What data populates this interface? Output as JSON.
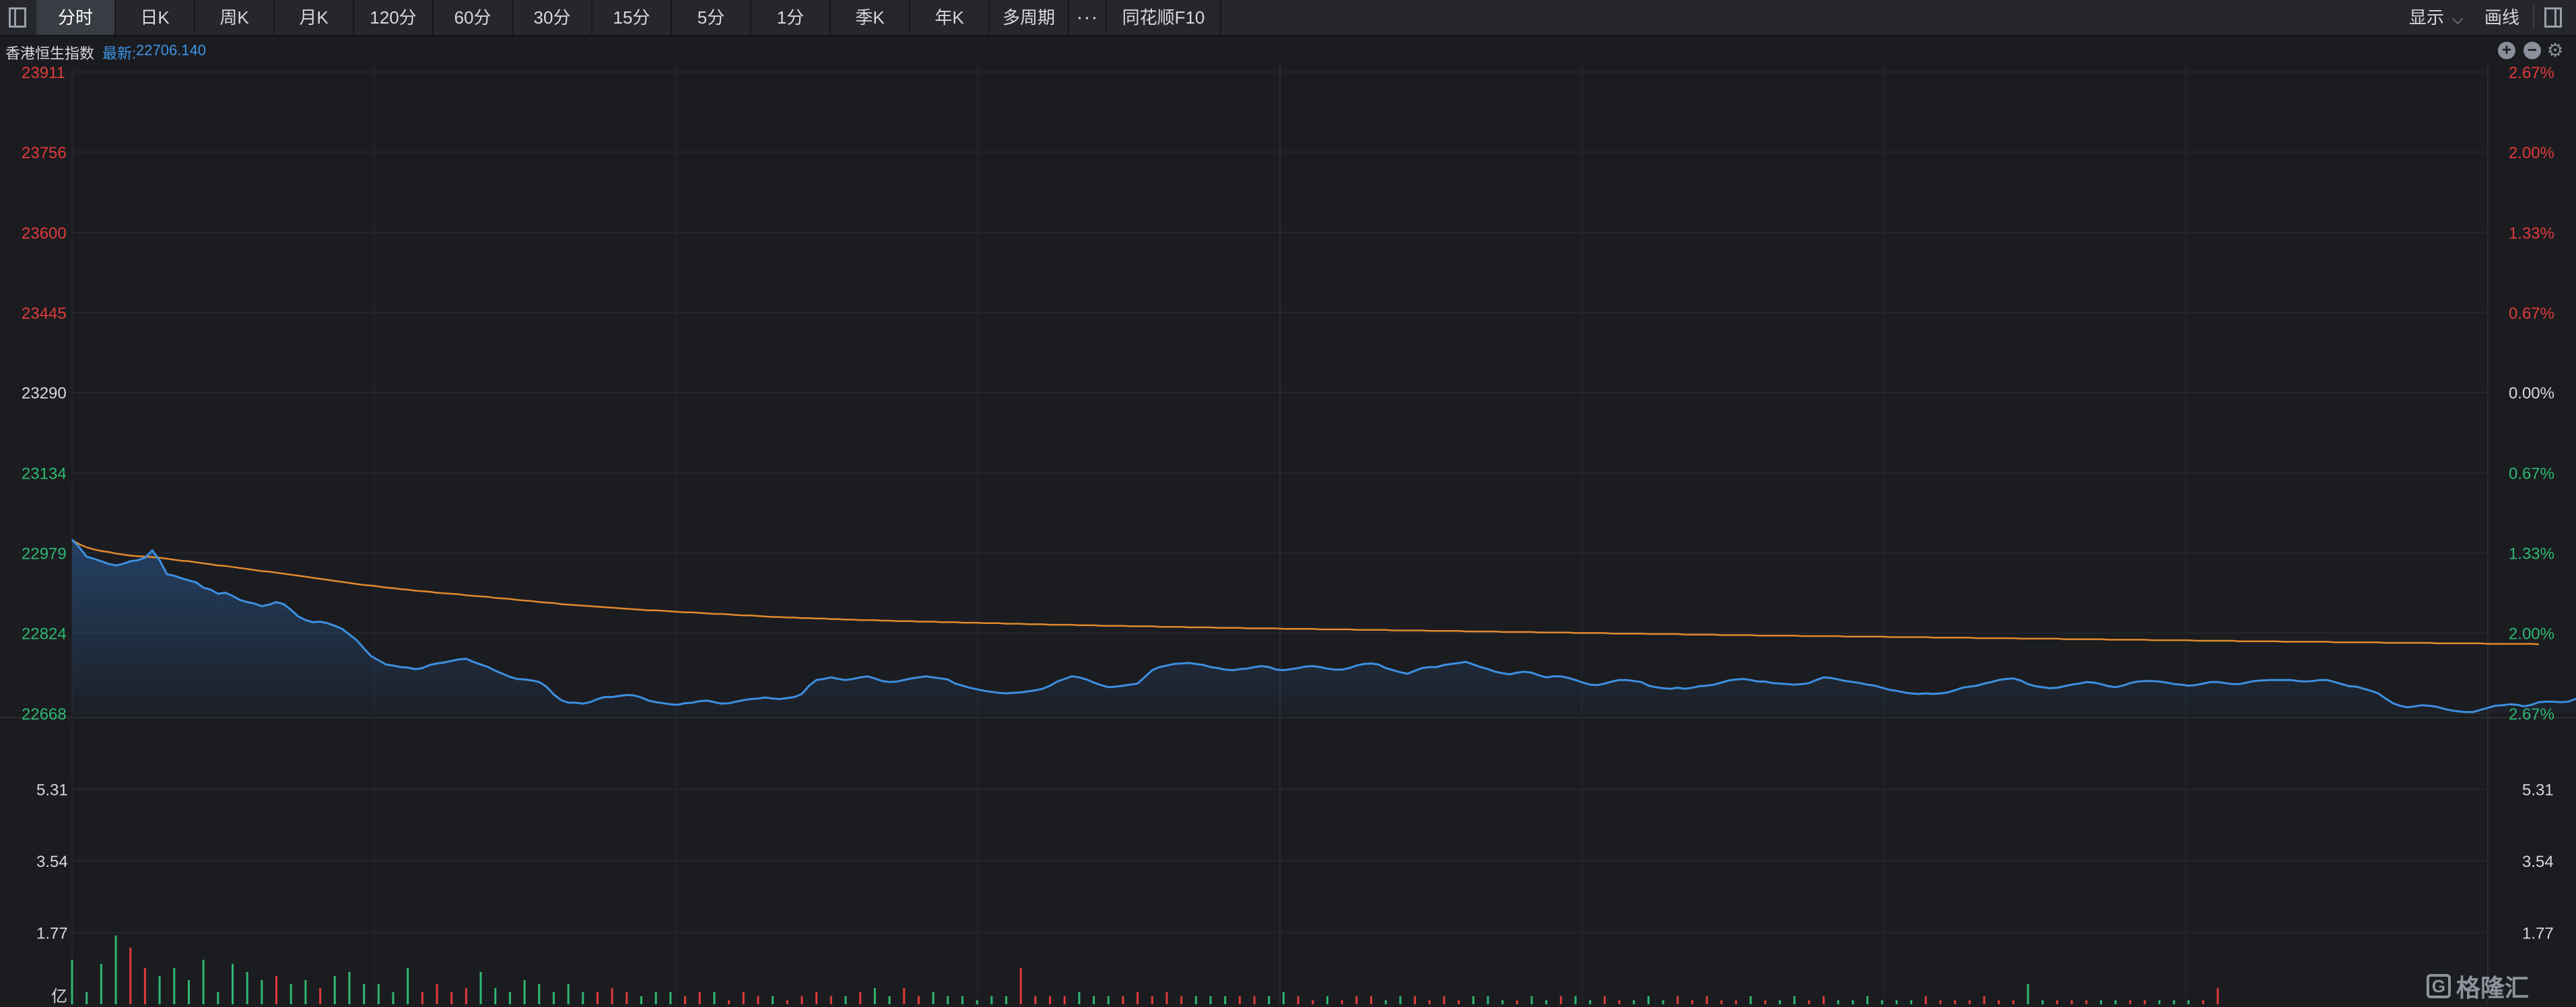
{
  "toolbar": {
    "tabs": [
      "分时",
      "日K",
      "周K",
      "月K",
      "120分",
      "60分",
      "30分",
      "15分",
      "5分",
      "1分",
      "季K",
      "年K",
      "多周期"
    ],
    "active_tab": "分时",
    "more": "···",
    "f10": "同花顺F10",
    "show_label": "显示",
    "draw_label": "画线"
  },
  "info": {
    "name": "香港恒生指数",
    "latest_label": "最新:",
    "latest_value": "22706.140"
  },
  "colors": {
    "up": "#e03b3b",
    "down": "#2eb872",
    "neutral": "#d6d8dc",
    "price_line": "#3d8fe0",
    "avg_line": "#e08a2c"
  },
  "chart_data": [
    {
      "type": "line",
      "name": "price",
      "y_ticks": [
        "23911",
        "23756",
        "23600",
        "23445",
        "23290",
        "23134",
        "22979",
        "22824",
        "22668"
      ],
      "y_tick_values": [
        23911,
        23756,
        23600,
        23445,
        23290,
        23134,
        22979,
        22824,
        22668
      ],
      "pct_ticks": [
        "2.67%",
        "2.00%",
        "1.33%",
        "0.67%",
        "0.00%",
        "0.67%",
        "1.33%",
        "2.00%",
        "2.67%"
      ],
      "ylim": [
        22668,
        23911
      ],
      "prev_close": 23290,
      "x_points_total": 331,
      "series": [
        {
          "name": "price",
          "values": [
            23005,
            22990,
            22972,
            22968,
            22963,
            22958,
            22955,
            22958,
            22963,
            22965,
            22970,
            22984,
            22965,
            22938,
            22935,
            22930,
            22926,
            22922,
            22912,
            22908,
            22900,
            22902,
            22896,
            22888,
            22884,
            22881,
            22876,
            22879,
            22884,
            22880,
            22869,
            22856,
            22849,
            22845,
            22846,
            22843,
            22838,
            22832,
            22821,
            22810,
            22794,
            22779,
            22771,
            22763,
            22761,
            22758,
            22757,
            22754,
            22756,
            22762,
            22765,
            22767,
            22770,
            22773,
            22774,
            22768,
            22763,
            22758,
            22751,
            22745,
            22739,
            22735,
            22734,
            22732,
            22729,
            22720,
            22705,
            22694,
            22689,
            22689,
            22687,
            22690,
            22696,
            22700,
            22700,
            22702,
            22704,
            22703,
            22699,
            22693,
            22690,
            22688,
            22686,
            22685,
            22688,
            22689,
            22692,
            22693,
            22690,
            22687,
            22688,
            22691,
            22694,
            22696,
            22697,
            22699,
            22697,
            22696,
            22698,
            22700,
            22706,
            22722,
            22733,
            22735,
            22738,
            22735,
            22733,
            22735,
            22738,
            22740,
            22736,
            22731,
            22729,
            22730,
            22733,
            22736,
            22738,
            22740,
            22738,
            22736,
            22734,
            22726,
            22722,
            22718,
            22715,
            22712,
            22710,
            22708,
            22707,
            22708,
            22709,
            22711,
            22713,
            22716,
            22722,
            22730,
            22735,
            22740,
            22738,
            22734,
            22728,
            22723,
            22719,
            22720,
            22722,
            22724,
            22726,
            22739,
            22752,
            22758,
            22761,
            22764,
            22765,
            22766,
            22764,
            22762,
            22758,
            22756,
            22753,
            22752,
            22754,
            22755,
            22758,
            22760,
            22758,
            22753,
            22752,
            22754,
            22756,
            22759,
            22760,
            22758,
            22755,
            22753,
            22753,
            22756,
            22761,
            22764,
            22765,
            22763,
            22756,
            22752,
            22748,
            22745,
            22751,
            22756,
            22758,
            22758,
            22762,
            22764,
            22766,
            22768,
            22763,
            22758,
            22754,
            22749,
            22746,
            22744,
            22747,
            22749,
            22747,
            22742,
            22738,
            22740,
            22740,
            22737,
            22733,
            22728,
            22724,
            22723,
            22726,
            22730,
            22733,
            22733,
            22731,
            22729,
            22722,
            22719,
            22717,
            22716,
            22718,
            22716,
            22718,
            22721,
            22722,
            22724,
            22728,
            22732,
            22734,
            22735,
            22733,
            22730,
            22730,
            22727,
            22726,
            22725,
            22724,
            22725,
            22727,
            22733,
            22738,
            22737,
            22734,
            22731,
            22729,
            22727,
            22724,
            22722,
            22718,
            22714,
            22712,
            22709,
            22707,
            22706,
            22707,
            22706,
            22707,
            22709,
            22713,
            22718,
            22720,
            22722,
            22726,
            22729,
            22733,
            22735,
            22736,
            22732,
            22725,
            22721,
            22719,
            22717,
            22718,
            22721,
            22724,
            22726,
            22729,
            22728,
            22725,
            22721,
            22719,
            22722,
            22727,
            22730,
            22731,
            22731,
            22730,
            22728,
            22725,
            22724,
            22722,
            22723,
            22726,
            22729,
            22729,
            22727,
            22725,
            22725,
            22728,
            22731,
            22732,
            22733,
            22733,
            22733,
            22733,
            22731,
            22730,
            22731,
            22733,
            22733,
            22729,
            22725,
            22721,
            22720,
            22716,
            22712,
            22707,
            22697,
            22688,
            22683,
            22680,
            22682,
            22684,
            22683,
            22681,
            22677,
            22674,
            22672,
            22671,
            22671,
            22675,
            22679,
            22683,
            22684,
            22686,
            22685,
            22682,
            22685,
            22690,
            22691,
            22691,
            22690,
            22691,
            22696,
            22701,
            22706
          ]
        },
        {
          "name": "average",
          "values": [
            23004,
            22996,
            22990,
            22986,
            22983,
            22981,
            22978,
            22976,
            22974,
            22973,
            22972,
            22971,
            22970,
            22968,
            22966,
            22964,
            22963,
            22961,
            22959,
            22957,
            22955,
            22954,
            22952,
            22950,
            22948,
            22946,
            22944,
            22943,
            22941,
            22939,
            22937,
            22935,
            22933,
            22931,
            22929,
            22927,
            22925,
            22923,
            22921,
            22919,
            22917,
            22916,
            22914,
            22912,
            22911,
            22909,
            22908,
            22906,
            22905,
            22904,
            22902,
            22901,
            22900,
            22899,
            22897,
            22896,
            22895,
            22894,
            22892,
            22891,
            22890,
            22888,
            22887,
            22886,
            22884,
            22883,
            22882,
            22880,
            22879,
            22878,
            22877,
            22876,
            22875,
            22874,
            22873,
            22872,
            22871,
            22870,
            22869,
            22868,
            22868,
            22867,
            22866,
            22865,
            22864,
            22864,
            22863,
            22862,
            22861,
            22861,
            22860,
            22859,
            22858,
            22858,
            22857,
            22856,
            22855,
            22855,
            22854,
            22854,
            22853,
            22853,
            22852,
            22852,
            22851,
            22851,
            22850,
            22850,
            22849,
            22849,
            22849,
            22848,
            22848,
            22847,
            22847,
            22847,
            22846,
            22846,
            22846,
            22845,
            22845,
            22845,
            22844,
            22844,
            22844,
            22843,
            22843,
            22843,
            22842,
            22842,
            22842,
            22841,
            22841,
            22841,
            22840,
            22840,
            22840,
            22840,
            22839,
            22839,
            22839,
            22838,
            22838,
            22838,
            22838,
            22837,
            22837,
            22837,
            22837,
            22836,
            22836,
            22836,
            22836,
            22835,
            22835,
            22835,
            22835,
            22834,
            22834,
            22834,
            22834,
            22833,
            22833,
            22833,
            22833,
            22833,
            22832,
            22832,
            22832,
            22832,
            22832,
            22831,
            22831,
            22831,
            22831,
            22831,
            22830,
            22830,
            22830,
            22830,
            22830,
            22829,
            22829,
            22829,
            22829,
            22829,
            22828,
            22828,
            22828,
            22828,
            22828,
            22827,
            22827,
            22827,
            22827,
            22827,
            22826,
            22826,
            22826,
            22826,
            22826,
            22825,
            22825,
            22825,
            22825,
            22825,
            22824,
            22824,
            22824,
            22824,
            22824,
            22823,
            22823,
            22823,
            22823,
            22823,
            22822,
            22822,
            22822,
            22822,
            22822,
            22821,
            22821,
            22821,
            22821,
            22821,
            22820,
            22820,
            22820,
            22820,
            22820,
            22819,
            22819,
            22819,
            22819,
            22819,
            22819,
            22818,
            22818,
            22818,
            22818,
            22818,
            22818,
            22817,
            22817,
            22817,
            22817,
            22817,
            22817,
            22816,
            22816,
            22816,
            22816,
            22816,
            22816,
            22815,
            22815,
            22815,
            22815,
            22815,
            22815,
            22814,
            22814,
            22814,
            22814,
            22814,
            22814,
            22813,
            22813,
            22813,
            22813,
            22813,
            22813,
            22812,
            22812,
            22812,
            22812,
            22812,
            22812,
            22811,
            22811,
            22811,
            22811,
            22811,
            22811,
            22810,
            22810,
            22810,
            22810,
            22810,
            22810,
            22809,
            22809,
            22809,
            22809,
            22809,
            22809,
            22808,
            22808,
            22808,
            22808,
            22808,
            22808,
            22807,
            22807,
            22807,
            22807,
            22807,
            22807,
            22807,
            22806,
            22806,
            22806,
            22806,
            22806,
            22806,
            22806,
            22805,
            22805,
            22805,
            22805,
            22805,
            22805,
            22805,
            22804,
            22804,
            22804,
            22804,
            22804,
            22804,
            22804,
            22803,
            22803,
            22803,
            22803,
            22803,
            22803,
            22803,
            22802
          ]
        }
      ]
    },
    {
      "type": "bar",
      "name": "volume",
      "y_ticks": [
        "5.31",
        "3.54",
        "1.77"
      ],
      "y_tick_values": [
        5.31,
        3.54,
        1.77
      ],
      "unit": "亿",
      "ylim": [
        0,
        7.08
      ],
      "values": [
        1.1,
        0.0,
        0.3,
        0.0,
        1.0,
        0.0,
        1.7,
        0.0,
        1.4,
        0.0,
        0.9,
        0.0,
        0.7,
        0.0,
        0.9,
        0.0,
        0.6,
        0.0,
        1.1,
        0.0,
        0.3,
        0.0,
        1.0,
        0.0,
        0.8,
        0.0,
        0.6,
        0.0,
        0.7,
        0.0,
        0.5,
        0.0,
        0.6,
        0.0,
        0.4,
        0.0,
        0.7,
        0.0,
        0.8,
        0.0,
        0.5,
        0.0,
        0.5,
        0.0,
        0.3,
        0.0,
        0.9,
        0.0,
        0.3,
        0.0,
        0.5,
        0.0,
        0.3,
        0.0,
        0.4,
        0.0,
        0.8,
        0.0,
        0.4,
        0.0,
        0.3,
        0.0,
        0.6,
        0.0,
        0.5,
        0.0,
        0.3,
        0.0,
        0.5,
        0.0,
        0.3,
        0.0,
        0.3,
        0.0,
        0.4,
        0.0,
        0.3,
        0.0,
        0.2,
        0.0,
        0.3,
        0.0,
        0.3,
        0.0,
        0.2,
        0.0,
        0.3,
        0.0,
        0.3,
        0.0,
        0.1,
        0.0,
        0.3,
        0.0,
        0.2,
        0.0,
        0.2,
        0.0,
        0.1,
        0.0,
        0.2,
        0.0,
        0.3,
        0.0,
        0.2,
        0.0,
        0.2,
        0.0,
        0.3,
        0.0,
        0.4,
        0.0,
        0.2,
        0.0,
        0.4,
        0.0,
        0.2,
        0.0,
        0.3,
        0.0,
        0.2,
        0.0,
        0.2,
        0.0,
        0.1,
        0.0,
        0.2,
        0.0,
        0.2,
        0.0,
        0.9,
        0.0,
        0.2,
        0.0,
        0.2,
        0.0,
        0.2,
        0.0,
        0.3,
        0.0,
        0.2,
        0.0,
        0.2,
        0.0,
        0.2,
        0.0,
        0.3,
        0.0,
        0.2,
        0.0,
        0.3,
        0.0,
        0.2,
        0.0,
        0.2,
        0.0,
        0.2,
        0.0,
        0.2,
        0.0,
        0.2,
        0.0,
        0.2,
        0.0,
        0.2,
        0.0,
        0.3,
        0.0,
        0.2,
        0.0,
        0.1,
        0.0,
        0.2,
        0.0,
        0.1,
        0.0,
        0.2,
        0.0,
        0.2,
        0.0,
        0.1,
        0.0,
        0.2,
        0.0,
        0.2,
        0.0,
        0.1,
        0.0,
        0.2,
        0.0,
        0.1,
        0.0,
        0.2,
        0.0,
        0.2,
        0.0,
        0.1,
        0.0,
        0.1,
        0.0,
        0.2,
        0.0,
        0.1,
        0.0,
        0.2,
        0.0,
        0.2,
        0.0,
        0.1,
        0.0,
        0.2,
        0.0,
        0.1,
        0.0,
        0.1,
        0.0,
        0.2,
        0.0,
        0.1,
        0.0,
        0.2,
        0.0,
        0.1,
        0.0,
        0.2,
        0.0,
        0.1,
        0.0,
        0.1,
        0.0,
        0.2,
        0.0,
        0.1,
        0.0,
        0.1,
        0.0,
        0.2,
        0.0,
        0.1,
        0.0,
        0.2,
        0.0,
        0.1,
        0.0,
        0.1,
        0.0,
        0.2,
        0.0,
        0.1,
        0.0,
        0.1,
        0.0,
        0.1,
        0.0,
        0.2,
        0.0,
        0.1,
        0.0,
        0.1,
        0.0,
        0.1,
        0.0,
        0.2,
        0.0,
        0.1,
        0.0,
        0.1,
        0.0,
        0.5,
        0.0,
        0.1,
        0.0,
        0.1,
        0.0,
        0.1,
        0.0,
        0.1,
        0.0,
        0.1,
        0.0,
        0.1,
        0.0,
        0.1,
        0.0,
        0.1,
        0.0,
        0.1,
        0.0,
        0.1,
        0.0,
        0.1,
        0.0,
        0.1,
        0.0,
        0.4
      ]
    }
  ],
  "watermark": "格隆汇"
}
